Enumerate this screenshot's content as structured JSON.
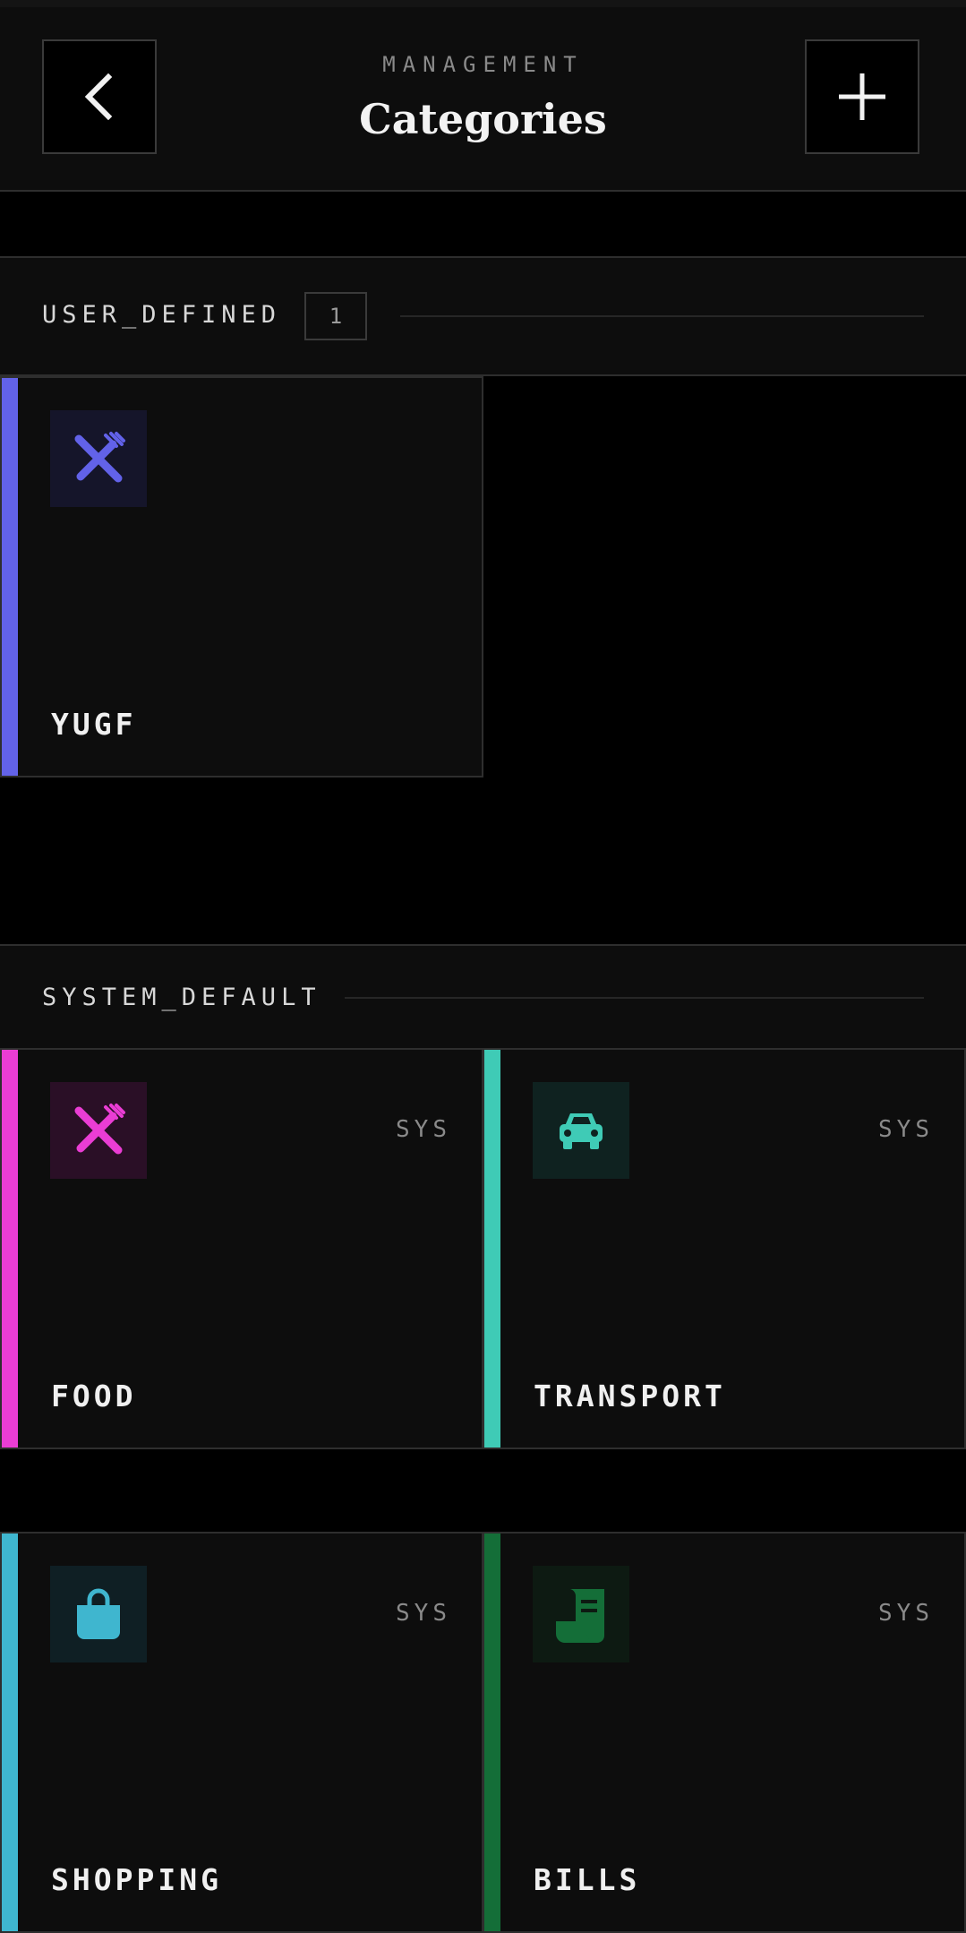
{
  "header": {
    "subtitle": "MANAGEMENT",
    "title": "Categories",
    "back_icon": "chevron-left-icon",
    "add_icon": "plus-icon"
  },
  "user_section": {
    "label": "USER_DEFINED",
    "count": "1",
    "items": [
      {
        "name": "YUGF",
        "icon": "utensils-icon",
        "color": "#6262e8",
        "icon_bg": "#15152a"
      }
    ]
  },
  "system_section": {
    "label": "SYSTEM_DEFAULT",
    "badge": "SYS",
    "items": [
      {
        "name": "FOOD",
        "icon": "utensils-icon",
        "color": "#ea3dd4",
        "icon_bg": "#2a0f26"
      },
      {
        "name": "TRANSPORT",
        "icon": "car-icon",
        "color": "#3fcbb6",
        "icon_bg": "#0f2220"
      },
      {
        "name": "SHOPPING",
        "icon": "shopping-bag-icon",
        "color": "#3fb6cf",
        "icon_bg": "#0f1f24"
      },
      {
        "name": "BILLS",
        "icon": "receipt-icon",
        "color": "#146e38",
        "icon_bg": "#0d1a12"
      }
    ]
  }
}
